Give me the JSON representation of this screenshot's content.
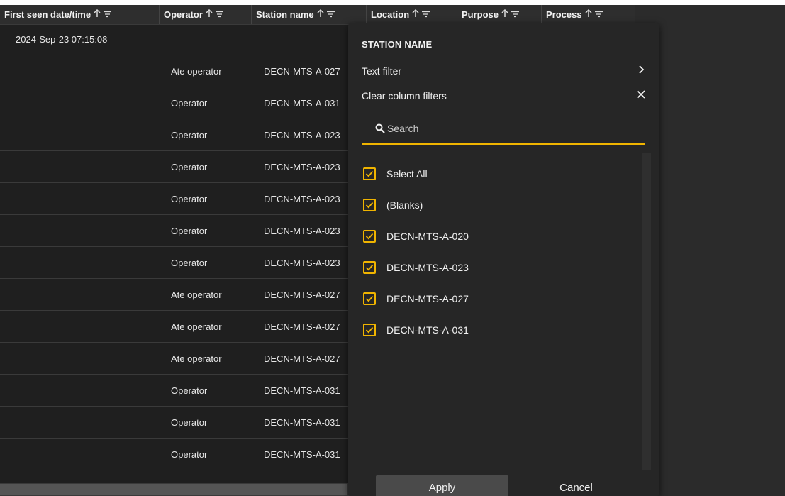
{
  "columns": [
    {
      "label": "First seen date/time",
      "width": 225
    },
    {
      "label": "Operator",
      "width": 130
    },
    {
      "label": "Station name",
      "width": 162
    },
    {
      "label": "Location",
      "width": 128
    },
    {
      "label": "Purpose",
      "width": 119
    },
    {
      "label": "Process",
      "width": 132
    }
  ],
  "rows": [
    {
      "first_seen": "2024-Sep-23 07:15:08",
      "operator": "",
      "station": ""
    },
    {
      "first_seen": "",
      "operator": "Ate operator",
      "station": "DECN-MTS-A-027"
    },
    {
      "first_seen": "",
      "operator": "Operator",
      "station": "DECN-MTS-A-031"
    },
    {
      "first_seen": "",
      "operator": "Operator",
      "station": "DECN-MTS-A-023"
    },
    {
      "first_seen": "",
      "operator": "Operator",
      "station": "DECN-MTS-A-023"
    },
    {
      "first_seen": "",
      "operator": "Operator",
      "station": "DECN-MTS-A-023"
    },
    {
      "first_seen": "",
      "operator": "Operator",
      "station": "DECN-MTS-A-023"
    },
    {
      "first_seen": "",
      "operator": "Operator",
      "station": "DECN-MTS-A-023"
    },
    {
      "first_seen": "",
      "operator": "Ate operator",
      "station": "DECN-MTS-A-027"
    },
    {
      "first_seen": "",
      "operator": "Ate operator",
      "station": "DECN-MTS-A-027"
    },
    {
      "first_seen": "",
      "operator": "Ate operator",
      "station": "DECN-MTS-A-027"
    },
    {
      "first_seen": "",
      "operator": "Operator",
      "station": "DECN-MTS-A-031"
    },
    {
      "first_seen": "",
      "operator": "Operator",
      "station": "DECN-MTS-A-031"
    },
    {
      "first_seen": "",
      "operator": "Operator",
      "station": "DECN-MTS-A-031"
    }
  ],
  "filter_popup": {
    "title": "STATION NAME",
    "text_filter_label": "Text filter",
    "clear_filters_label": "Clear column filters",
    "search_placeholder": "Search",
    "options": [
      {
        "label": "Select All",
        "checked": true
      },
      {
        "label": "(Blanks)",
        "checked": true
      },
      {
        "label": "DECN-MTS-A-020",
        "checked": true
      },
      {
        "label": "DECN-MTS-A-023",
        "checked": true
      },
      {
        "label": "DECN-MTS-A-027",
        "checked": true
      },
      {
        "label": "DECN-MTS-A-031",
        "checked": true
      }
    ],
    "apply_label": "Apply",
    "cancel_label": "Cancel"
  },
  "colors": {
    "accent": "#f0b400",
    "background": "#1f1f1f",
    "header": "#2e2e2e",
    "popup": "#262626"
  },
  "icons": {
    "sort": "arrow-up-icon",
    "filter": "filter-lines-icon",
    "submenu": "chevron-right-icon",
    "clear": "close-icon",
    "search": "search-icon",
    "check": "check-icon"
  }
}
